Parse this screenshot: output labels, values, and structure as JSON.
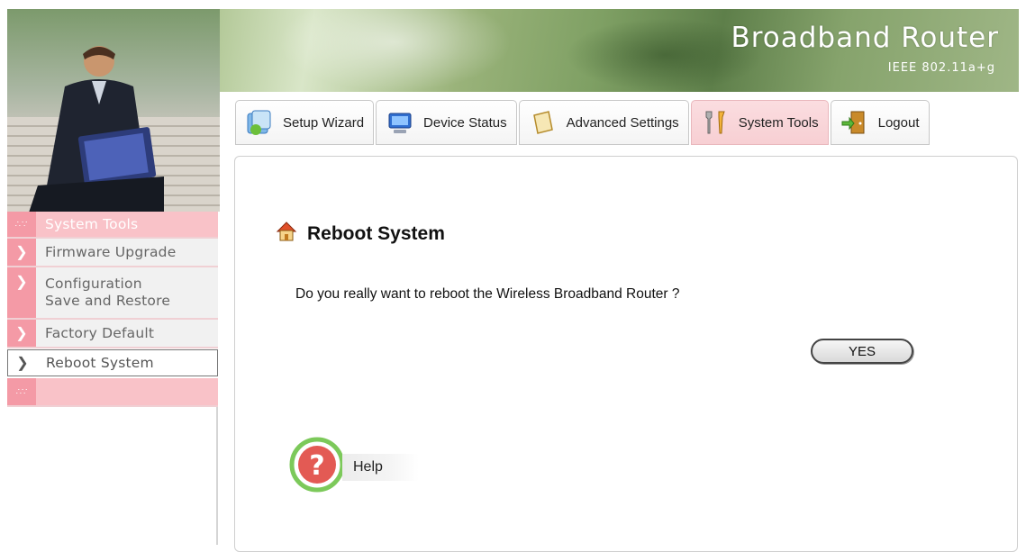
{
  "header": {
    "brand_title": "Broadband Router",
    "brand_subtitle": "IEEE 802.11a+g"
  },
  "tabs": [
    {
      "label": "Setup Wizard",
      "icon": "setup-wizard-icon",
      "active": false
    },
    {
      "label": "Device Status",
      "icon": "monitor-icon",
      "active": false
    },
    {
      "label": "Advanced Settings",
      "icon": "notepad-icon",
      "active": false
    },
    {
      "label": "System Tools",
      "icon": "tools-icon",
      "active": true
    },
    {
      "label": "Logout",
      "icon": "door-icon",
      "active": false
    }
  ],
  "sidebar": {
    "header": "System Tools",
    "items": [
      {
        "label": "Firmware Upgrade"
      },
      {
        "label_line1": "Configuration",
        "label_line2": "Save and Restore"
      },
      {
        "label": "Factory Default"
      },
      {
        "label": "Reboot System",
        "active": true
      }
    ]
  },
  "main": {
    "title": "Reboot System",
    "question": "Do you really want to reboot the Wireless Broadband Router ?",
    "yes_label": "YES",
    "help_label": "Help"
  },
  "colors": {
    "accent_pink": "#f9c2c8",
    "bullet_pink": "#f49aa6",
    "help_green": "#6bbf4e",
    "help_red": "#e0504a"
  }
}
